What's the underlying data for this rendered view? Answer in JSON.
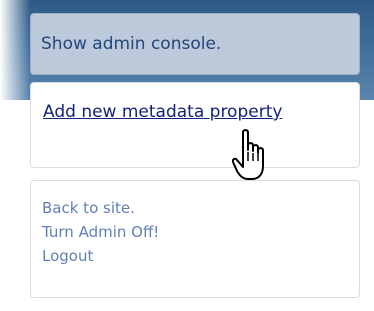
{
  "admin_console": {
    "label": "Show admin console."
  },
  "metadata": {
    "add_property_label": "Add new metadata property"
  },
  "site_links": [
    {
      "label": "Back to site."
    },
    {
      "label": "Turn Admin Off!"
    },
    {
      "label": "Logout"
    }
  ],
  "cursor": {
    "icon": "hand-pointer-icon"
  },
  "colors": {
    "banner": "#3d6b98",
    "admin_box": "#bcc9da",
    "link_primary": "#14227a",
    "link_secondary": "#5f7fb6"
  }
}
